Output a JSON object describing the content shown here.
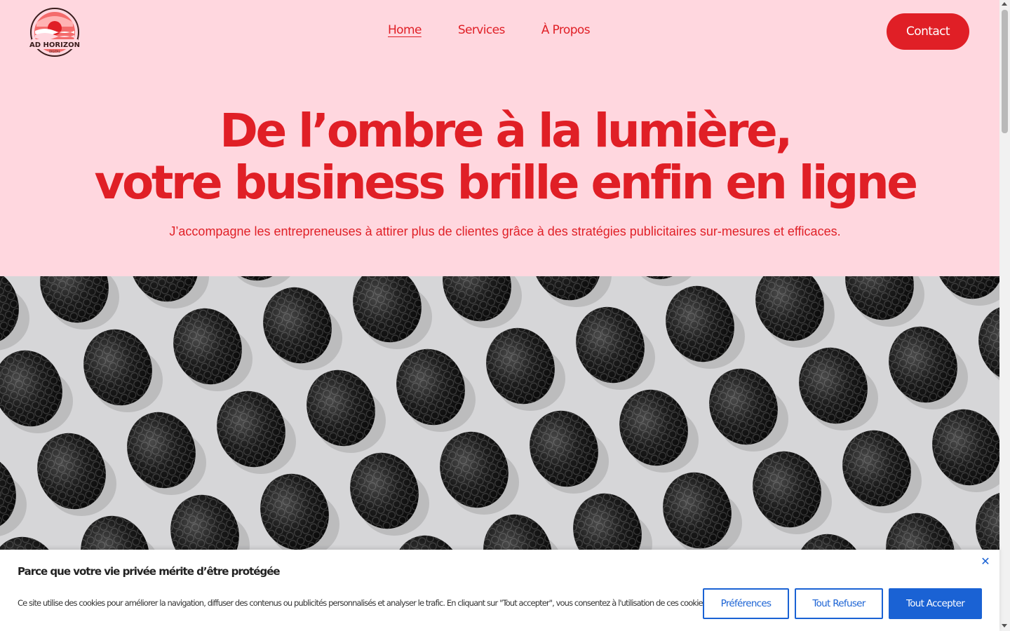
{
  "colors": {
    "accent": "#e01f26",
    "background": "#ffd7df",
    "cookie_button": "#1a62d4"
  },
  "header": {
    "logo": {
      "line1": "AD HORIZON",
      "line2": "DIGITAL"
    },
    "nav": [
      {
        "label": "Home",
        "active": true
      },
      {
        "label": "Services",
        "active": false
      },
      {
        "label": "À Propos",
        "active": false
      }
    ],
    "contact_label": "Contact"
  },
  "hero": {
    "title_line1": "De l’ombre à la lumière,",
    "title_line2": "votre business brille enfin en ligne",
    "subtitle": "J’accompagne les entrepreneuses à attirer plus de clientes grâce à des stratégies publicitaires sur-mesures et efficaces."
  },
  "cookie_banner": {
    "title": "Parce que votre vie privée mérite d’être protégée",
    "text": "Ce site utilise des cookies pour améliorer la navigation, diffuser des contenus ou publicités personnalisés et analyser le trafic. En cliquant sur \"Tout accepter\", vous consentez à l'utilisation de ces cookies.",
    "preferences_label": "Préférences",
    "refuse_label": "Tout Refuser",
    "accept_label": "Tout Accepter",
    "close_icon": "close-icon"
  }
}
